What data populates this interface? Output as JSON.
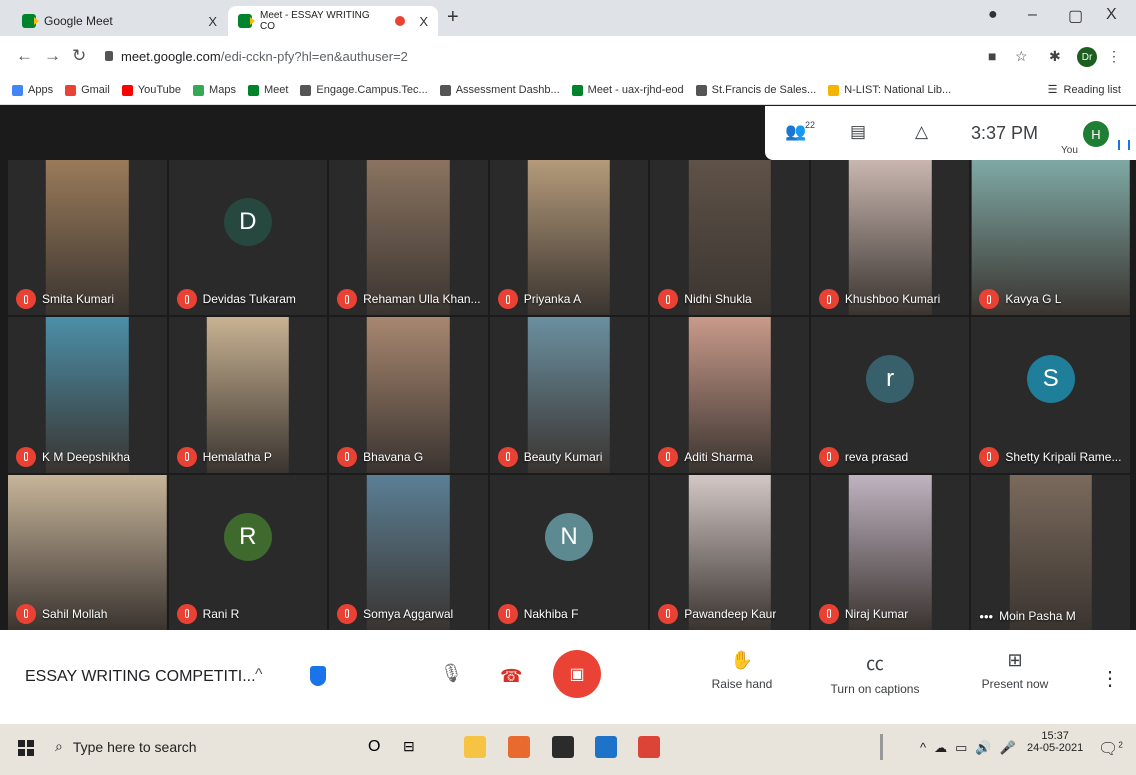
{
  "browser": {
    "tabs": [
      {
        "title": "Google Meet",
        "close": "X"
      },
      {
        "title": "Meet - ESSAY WRITING CO",
        "close": "X"
      }
    ],
    "new_tab": "+",
    "window_controls": {
      "minimize": "–",
      "restore": "▢",
      "close": "X"
    },
    "url_host": "meet.google.com",
    "url_path": "/edi-cckn-pfy?hl=en&authuser=2",
    "profile_initials": "Dr",
    "bookmarks": [
      {
        "label": "Apps",
        "color": "#4285f4"
      },
      {
        "label": "Gmail",
        "color": "#ea4335"
      },
      {
        "label": "YouTube",
        "color": "#ff0000"
      },
      {
        "label": "Maps",
        "color": "#34a853"
      },
      {
        "label": "Meet",
        "color": "#00832d"
      },
      {
        "label": "Engage.Campus.Tec...",
        "color": "#555555"
      },
      {
        "label": "Assessment Dashb...",
        "color": "#555555"
      },
      {
        "label": "Meet - uax-rjhd-eod",
        "color": "#00832d"
      },
      {
        "label": "St.Francis de Sales...",
        "color": "#555555"
      },
      {
        "label": "N-LIST: National Lib...",
        "color": "#f4b400"
      }
    ],
    "reading_list": "Reading list"
  },
  "meet": {
    "participant_count": "22",
    "time": "3:37 PM",
    "self_initial": "H",
    "self_label": "You",
    "meeting_title": "ESSAY WRITING COMPETITI...",
    "controls": {
      "raise_hand": "Raise hand",
      "captions": "Turn on captions",
      "present": "Present now"
    }
  },
  "participants": [
    {
      "name": "Smita Kumari",
      "video": "#9a7b5a"
    },
    {
      "name": "Devidas Tukaram",
      "initial": "D",
      "color": "#26483f"
    },
    {
      "name": "Rehaman Ulla Khan...",
      "video": "#8a7360"
    },
    {
      "name": "Priyanka A",
      "video": "#b49a7a"
    },
    {
      "name": "Nidhi Shukla",
      "video": "#5f5248"
    },
    {
      "name": "Khushboo Kumari",
      "video": "#c9b6b0"
    },
    {
      "name": "Kavya G L",
      "video": "#7fa9a4",
      "full": true
    },
    {
      "name": "K M Deepshikha",
      "video": "#4b8fa8"
    },
    {
      "name": "Hemalatha P",
      "video": "#c8b292"
    },
    {
      "name": "Bhavana G",
      "video": "#a88770"
    },
    {
      "name": "Beauty Kumari",
      "video": "#6b8fa0"
    },
    {
      "name": "Aditi Sharma",
      "video": "#c99a8a"
    },
    {
      "name": "reva prasad",
      "initial": "r",
      "color": "#37606a"
    },
    {
      "name": "Shetty Kripali Rame...",
      "initial": "S",
      "color": "#1f7f9a"
    },
    {
      "name": "Sahil Mollah",
      "video": "#c7b59a",
      "full": true
    },
    {
      "name": "Rani R",
      "initial": "R",
      "color": "#3e6a2e"
    },
    {
      "name": "Somya Aggarwal",
      "video": "#5b7f95"
    },
    {
      "name": "Nakhiba F",
      "initial": "N",
      "color": "#5d8a90"
    },
    {
      "name": "Pawandeep Kaur",
      "video": "#d2c7c5"
    },
    {
      "name": "Niraj Kumar",
      "video": "#bfb3c0"
    },
    {
      "name": "Moin Pasha M",
      "video": "#7a6a5c",
      "more": "•••"
    }
  ],
  "taskbar": {
    "search_placeholder": "Type here to search",
    "time": "15:37",
    "date": "24-05-2021",
    "notification_count": "2",
    "apps": [
      {
        "name": "file-explorer",
        "color": "#f6c343"
      },
      {
        "name": "photos",
        "color": "#e86a2e"
      },
      {
        "name": "store",
        "color": "#2b2b2b"
      },
      {
        "name": "mail",
        "color": "#1e73c8"
      },
      {
        "name": "chrome",
        "color": "#db4437"
      }
    ]
  }
}
